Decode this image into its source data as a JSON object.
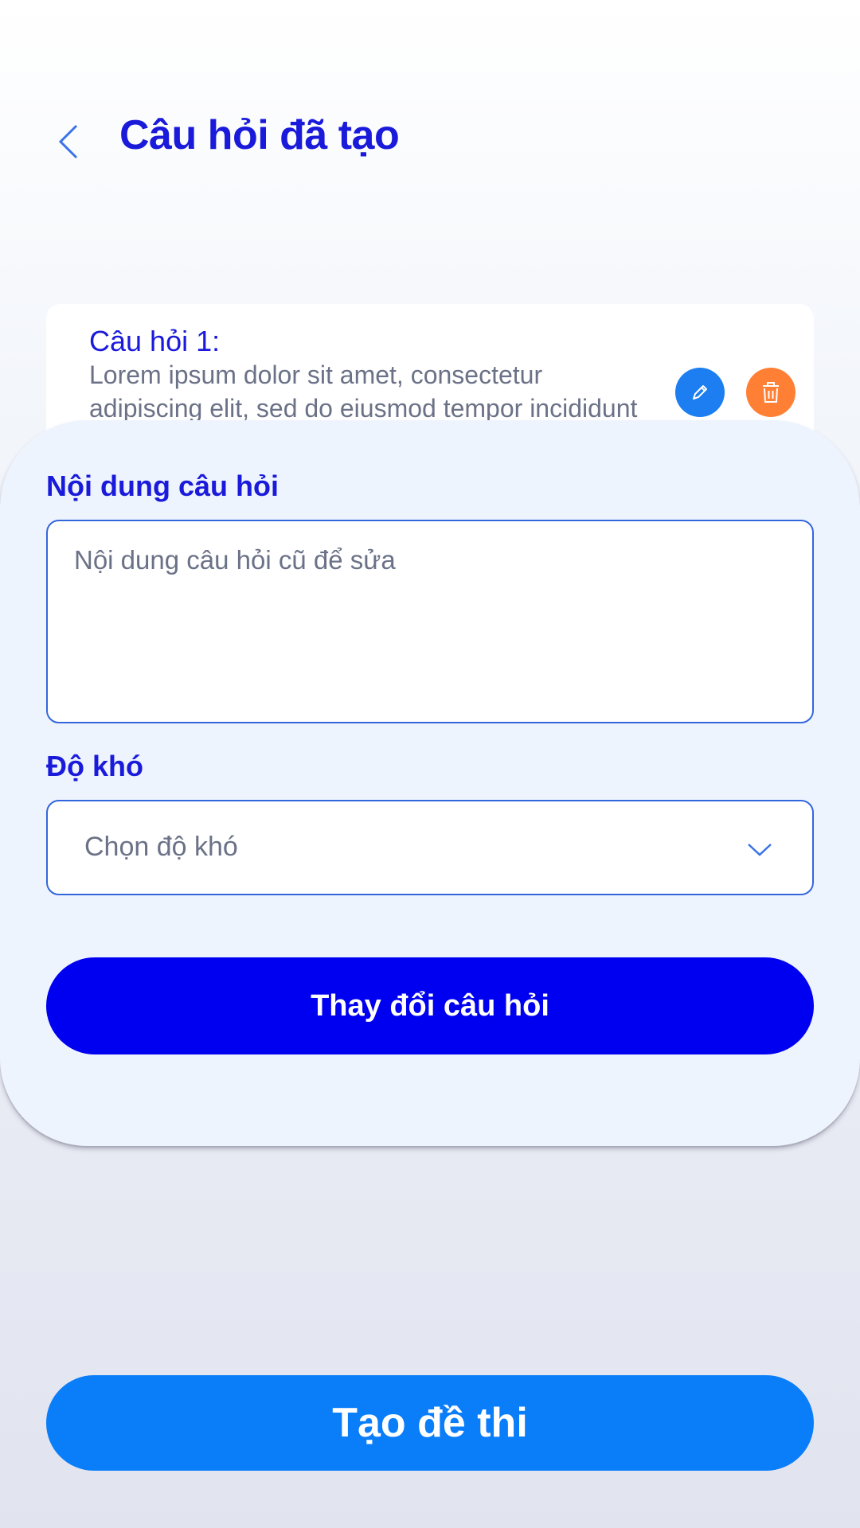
{
  "header": {
    "title": "Câu hỏi đã tạo"
  },
  "question_card": {
    "title": "Câu hỏi 1:",
    "text": "Lorem ipsum dolor sit amet, consectetur adipiscing elit, sed do eiusmod tempor incididunt"
  },
  "form": {
    "content_label": "Nội dung câu hỏi",
    "content_placeholder": "Nội dung câu hỏi cũ để sửa",
    "difficulty_label": "Độ khó",
    "difficulty_placeholder": "Chọn độ khó",
    "submit_label": "Thay đổi câu hỏi"
  },
  "footer": {
    "create_label": "Tạo đề thi"
  },
  "colors": {
    "title": "#1a1adb",
    "edit": "#1c7ef0",
    "delete": "#ff7f35",
    "primary_button": "#0000f0",
    "create_button": "#0a7df9"
  }
}
